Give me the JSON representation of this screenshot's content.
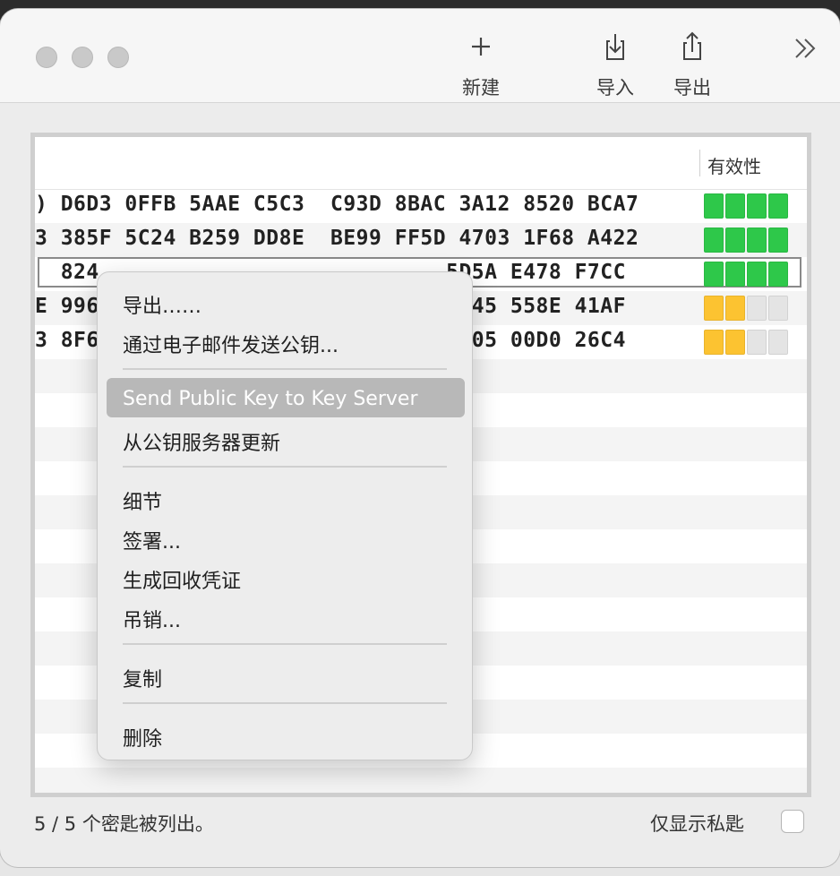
{
  "toolbar": {
    "new_label": "新建",
    "import_label": "导入",
    "export_label": "导出"
  },
  "table": {
    "header_validity": "有效性",
    "rows": [
      {
        "fingerprint": ") D6D3 0FFB 5AAE C5C3  C93D 8BAC 3A12 8520 BCA7",
        "validity": [
          "green",
          "green",
          "green",
          "green"
        ]
      },
      {
        "fingerprint": "3 385F 5C24 B259 DD8E  BE99 FF5D 4703 1F68 A422",
        "validity": [
          "green",
          "green",
          "green",
          "green"
        ]
      },
      {
        "fingerprint": "  824                           5D5A E478 F7CC",
        "validity": [
          "green",
          "green",
          "green",
          "green"
        ]
      },
      {
        "fingerprint": "E 996                         E 3745 558E 41AF",
        "validity": [
          "yellow",
          "yellow",
          "gray",
          "gray"
        ]
      },
      {
        "fingerprint": "3 8F6                         7 8F05 00D0 26C4",
        "validity": [
          "yellow",
          "yellow",
          "gray",
          "gray"
        ]
      }
    ]
  },
  "context_menu": {
    "items": [
      "导出……",
      "通过电子邮件发送公钥...",
      "Send Public Key to Key Server",
      "从公钥服务器更新",
      "细节",
      "签署...",
      "生成回收凭证",
      "吊销...",
      "复制",
      "删除"
    ],
    "highlighted_index": 2
  },
  "status": {
    "count_text": "5 / 5 个密匙被列出。",
    "private_only_label": "仅显示私匙",
    "private_only_checked": false
  },
  "colors": {
    "green": "#2ec84a",
    "yellow": "#fcc331",
    "gray": "#e4e4e4"
  }
}
